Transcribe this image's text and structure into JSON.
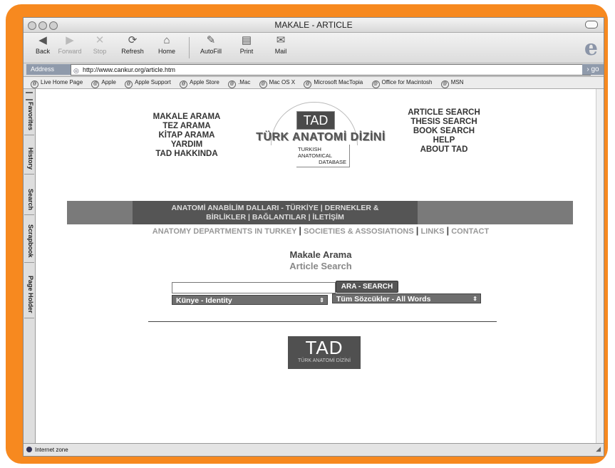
{
  "window": {
    "title": "MAKALE - ARTICLE"
  },
  "toolbar": {
    "back": "Back",
    "forward": "Forward",
    "stop": "Stop",
    "refresh": "Refresh",
    "home": "Home",
    "autofill": "AutoFill",
    "print": "Print",
    "mail": "Mail"
  },
  "address": {
    "label": "Address",
    "url": "http://www.cankur.org/article.htm",
    "go": "go"
  },
  "favorites": [
    "Live Home Page",
    "Apple",
    "Apple Support",
    "Apple Store",
    ".Mac",
    "Mac OS X",
    "Microsoft MacTopia",
    "Office for Macintosh",
    "MSN"
  ],
  "sidebar_tabs": [
    "Favorites",
    "History",
    "Search",
    "Scrapbook",
    "Page Holder"
  ],
  "nav_tr": [
    "MAKALE ARAMA",
    "TEZ ARAMA",
    "KİTAP ARAMA",
    "YARDIM",
    "TAD HAKKINDA"
  ],
  "nav_en": [
    "ARTICLE SEARCH",
    "THESIS SEARCH",
    "BOOK SEARCH",
    "HELP",
    "ABOUT TAD"
  ],
  "logo": {
    "abbr": "TAD",
    "name": "TÜRK ANATOMİ DİZİNİ",
    "sub": [
      "TURKISH",
      "ANATOMICAL",
      "DATABASE"
    ]
  },
  "links_tr": [
    "ANATOMİ ANABİLİM DALLARI - TÜRKİYE | DERNEKLER &",
    "BİRLİKLER | BAĞLANTILAR | İLETİŞİM"
  ],
  "links_en": [
    "ANATOMY DEPARTMENTS IN TURKEY",
    "SOCIETIES & ASSOSIATIONS",
    "LINKS",
    "CONTACT"
  ],
  "heading": {
    "tr": "Makale Arama",
    "en": "Article Search"
  },
  "search": {
    "value": "",
    "button": "ARA - SEARCH",
    "field_select": "Künye - Identity",
    "words_select": "Tüm Sözcükler - All Words"
  },
  "footer_logo": {
    "abbr": "TAD",
    "name": "TÜRK ANATOMİ DİZİNİ"
  },
  "status": {
    "zone": "Internet zone"
  },
  "colors": {
    "frame": "#f7891f",
    "band": "#7a7a7a",
    "band_dark": "#555555"
  }
}
